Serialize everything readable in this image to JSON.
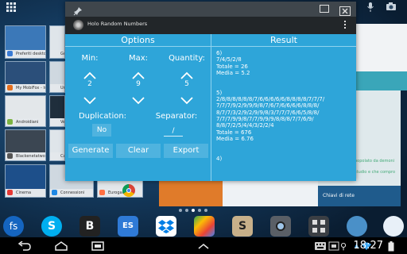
{
  "app": {
    "title": "Holo Random Numbers",
    "options_header": "Options",
    "result_header": "Result",
    "min_label": "Min:",
    "max_label": "Max:",
    "quantity_label": "Quantity:",
    "min_value": "2",
    "max_value": "9",
    "quantity_value": "5",
    "duplication_label": "Duplication:",
    "duplication_value": "No",
    "separator_label": "Separator:",
    "separator_value": "/",
    "generate_label": "Generate",
    "clear_label": "Clear",
    "export_label": "Export",
    "result_text": "6)\n7/4/5/2/8\nTotale = 26\nMedia = 5.2\n\n\n5)\n2/8/8/8/8/8/8/7/6/6/6/6/6/8/8/8/8/7/7/7/\n7/7/7/9/2/9/9/9/8/7/6/7/6/6/6/6/8/8/8/\n8/7/7/3/2/9/2/9/9/8/3/7/7/7/6/6/5/8/8/\n7/7/7/9/9/8/7/7/9/9/9/8/8/8/7/7/6/9/\n8/8/7/2/5/4/4/3/2/2/4\nTotale = 676\nMedia = 6.76\n\n\n4)"
  },
  "background": {
    "thumbnails": [
      {
        "label": "Preferiti desktop"
      },
      {
        "label": "Go"
      },
      {
        "label": "My MobiFox - Inventory"
      },
      {
        "label": "Un"
      },
      {
        "label": "Androidiani"
      },
      {
        "label": "Ve"
      },
      {
        "label": "Blackenetatworkstation"
      },
      {
        "label": "Cal"
      },
      {
        "label": "Cinema"
      },
      {
        "label": "Connessioni"
      },
      {
        "label": "Euroganm"
      }
    ],
    "right_window_text_1": "popolato da demoni",
    "right_window_text_2": "studio e che compro",
    "right_window_text_3": "Chiavi di rete"
  },
  "status": {
    "time": "18:27"
  },
  "colors": {
    "app_bg": "#2ea5d9",
    "button_bg": "#4fb3df",
    "title_bar": "#3f464c",
    "action_bar": "#222629"
  }
}
